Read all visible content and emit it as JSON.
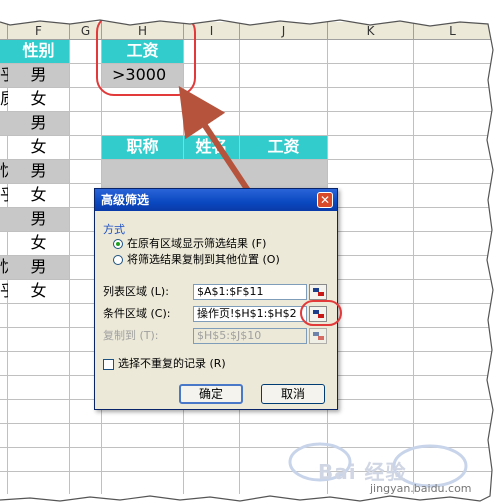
{
  "columns": [
    {
      "id": "F",
      "label": "F"
    },
    {
      "id": "G",
      "label": "G"
    },
    {
      "id": "H",
      "label": "H"
    },
    {
      "id": "I",
      "label": "I"
    },
    {
      "id": "J",
      "label": "J"
    },
    {
      "id": "K",
      "label": "K"
    },
    {
      "id": "L",
      "label": "L"
    }
  ],
  "sheet": {
    "partial_col_header": "性别",
    "gender_rows": [
      {
        "partial": "乎",
        "gender": "男",
        "shaded": true
      },
      {
        "partial": "质",
        "gender": "女",
        "shaded": false
      },
      {
        "partial": "",
        "gender": "男",
        "shaded": true
      },
      {
        "partial": "",
        "gender": "女",
        "shaded": false
      },
      {
        "partial": "忧",
        "gender": "男",
        "shaded": true
      },
      {
        "partial": "乎",
        "gender": "女",
        "shaded": false
      },
      {
        "partial": "",
        "gender": "男",
        "shaded": true
      },
      {
        "partial": "",
        "gender": "女",
        "shaded": false
      },
      {
        "partial": "忧",
        "gender": "男",
        "shaded": true
      },
      {
        "partial": "乎",
        "gender": "女",
        "shaded": false
      }
    ],
    "criteria_header": "工资",
    "criteria_value": ">3000",
    "output_headers": [
      "职称",
      "姓名",
      "工资"
    ]
  },
  "dialog": {
    "title": "高级筛选",
    "close_label": "✕",
    "group_label": "方式",
    "option_in_place": "在原有区域显示筛选结果 (F)",
    "option_copy": "将筛选结果复制到其他位置 (O)",
    "list_range_label": "列表区域 (L):",
    "list_range_value": "$A$1:$F$11",
    "criteria_range_label": "条件区域 (C):",
    "criteria_range_value": "操作页!$H$1:$H$2",
    "copy_to_label": "复制到 (T):",
    "copy_to_value": "$H$5:$J$10",
    "unique_label": "选择不重复的记录 (R)",
    "ok_label": "确定",
    "cancel_label": "取消"
  },
  "watermark": {
    "text": "Bai 经验",
    "url": "jingyan.baidu.com"
  },
  "colors": {
    "header_teal": "#33cccc",
    "highlight_red": "#e23a3a",
    "arrow_brown": "#b5533c"
  }
}
